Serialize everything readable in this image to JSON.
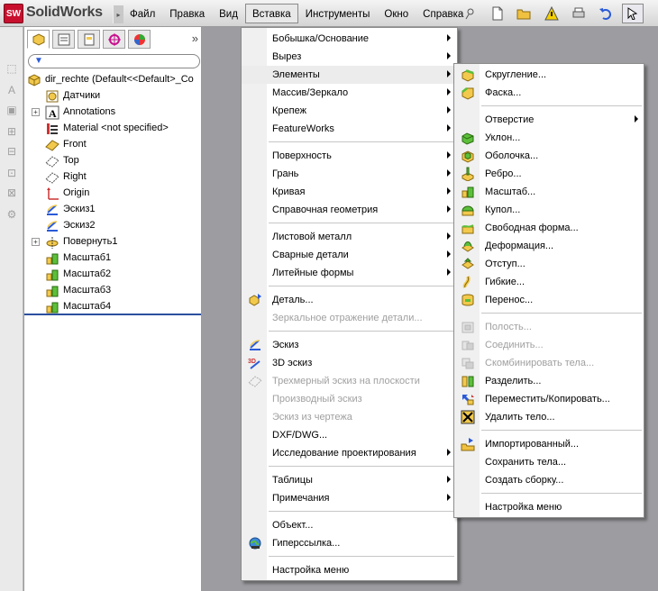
{
  "app": {
    "logo_mark": "SW",
    "name": "SolidWorks"
  },
  "menubar": [
    "Файл",
    "Правка",
    "Вид",
    "Вставка",
    "Инструменты",
    "Окно",
    "Справка"
  ],
  "colors": {
    "accent": "#2a4f9e",
    "brand": "#c8102e",
    "disabled": "#a0a0a0"
  },
  "tree": [
    {
      "label": "dir_rechte  (Default<<Default>_Co",
      "icon": "part-icon"
    },
    {
      "label": "Датчики",
      "icon": "sensor-icon"
    },
    {
      "label": "Annotations",
      "icon": "annotation-icon",
      "expandable": true
    },
    {
      "label": "Material <not specified>",
      "icon": "material-icon"
    },
    {
      "label": "Front",
      "icon": "plane-icon"
    },
    {
      "label": "Top",
      "icon": "plane-icon"
    },
    {
      "label": "Right",
      "icon": "plane-icon"
    },
    {
      "label": "Origin",
      "icon": "origin-icon"
    },
    {
      "label": "Эскиз1",
      "icon": "sketch-icon"
    },
    {
      "label": "Эскиз2",
      "icon": "sketch-icon"
    },
    {
      "label": "Повернуть1",
      "icon": "revolve-icon",
      "expandable": true
    },
    {
      "label": "Масштаб1",
      "icon": "scale-icon"
    },
    {
      "label": "Масштаб2",
      "icon": "scale-icon"
    },
    {
      "label": "Масштаб3",
      "icon": "scale-icon"
    },
    {
      "label": "Масштаб4",
      "icon": "scale-icon"
    }
  ],
  "insert_menu": [
    {
      "label": "Бобышка/Основание",
      "submenu": true
    },
    {
      "label": "Вырез",
      "submenu": true
    },
    {
      "label": "Элементы",
      "submenu": true,
      "highlighted": true
    },
    {
      "label": "Массив/Зеркало",
      "submenu": true
    },
    {
      "label": "Крепеж",
      "submenu": true
    },
    {
      "label": "FeatureWorks",
      "submenu": true
    },
    {
      "label": "Поверхность",
      "submenu": true
    },
    {
      "label": "Грань",
      "submenu": true
    },
    {
      "label": "Кривая",
      "submenu": true
    },
    {
      "label": "Справочная геометрия",
      "submenu": true
    },
    {
      "label": "Листовой металл",
      "submenu": true
    },
    {
      "label": "Сварные детали",
      "submenu": true
    },
    {
      "label": "Литейные формы",
      "submenu": true
    },
    {
      "label": "Деталь...",
      "icon": "part-insert-icon"
    },
    {
      "label": "Зеркальное отражение детали...",
      "disabled": true
    },
    {
      "label": "Эскиз",
      "icon": "sketch-icon"
    },
    {
      "label": "3D эскиз",
      "icon": "sketch3d-icon"
    },
    {
      "label": "Трехмерный эскиз на плоскости",
      "disabled": true,
      "icon": "sketch-plane-icon"
    },
    {
      "label": "Производный эскиз",
      "disabled": true
    },
    {
      "label": "Эскиз из чертежа",
      "disabled": true
    },
    {
      "label": "DXF/DWG..."
    },
    {
      "label": "Исследование проектирования",
      "submenu": true
    },
    {
      "label": "Таблицы",
      "submenu": true
    },
    {
      "label": "Примечания",
      "submenu": true
    },
    {
      "label": "Объект..."
    },
    {
      "label": "Гиперссылка...",
      "icon": "hyperlink-icon"
    },
    {
      "label": "Настройка меню"
    }
  ],
  "features_submenu": [
    {
      "label": "Скругление...",
      "icon": "fillet-icon"
    },
    {
      "label": "Фаска...",
      "icon": "chamfer-icon"
    },
    {
      "label": "Отверстие",
      "submenu": true
    },
    {
      "label": "Уклон...",
      "icon": "draft-icon"
    },
    {
      "label": "Оболочка...",
      "icon": "shell-icon"
    },
    {
      "label": "Ребро...",
      "icon": "rib-icon"
    },
    {
      "label": "Масштаб...",
      "icon": "scale-icon"
    },
    {
      "label": "Купол...",
      "icon": "dome-icon"
    },
    {
      "label": "Свободная форма...",
      "icon": "freeform-icon"
    },
    {
      "label": "Деформация...",
      "icon": "deform-icon"
    },
    {
      "label": "Отступ...",
      "icon": "indent-icon"
    },
    {
      "label": "Гибкие...",
      "icon": "flex-icon"
    },
    {
      "label": "Перенос...",
      "icon": "wrap-icon"
    },
    {
      "label": "Полость...",
      "disabled": true,
      "icon": "cavity-icon"
    },
    {
      "label": "Соединить...",
      "disabled": true,
      "icon": "join-icon"
    },
    {
      "label": "Скомбинировать тела...",
      "disabled": true,
      "icon": "combine-icon"
    },
    {
      "label": "Разделить...",
      "icon": "split-icon"
    },
    {
      "label": "Переместить/Копировать...",
      "icon": "move-copy-icon"
    },
    {
      "label": "Удалить тело...",
      "icon": "delete-body-icon"
    },
    {
      "label": "Импортированный...",
      "icon": "imported-icon"
    },
    {
      "label": "Сохранить тела..."
    },
    {
      "label": "Создать сборку..."
    },
    {
      "label": "Настройка меню"
    }
  ]
}
